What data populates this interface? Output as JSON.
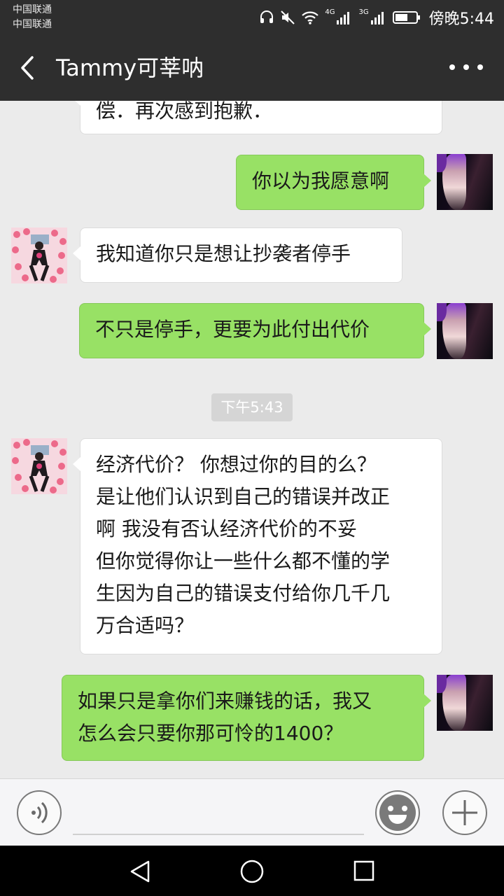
{
  "status_bar": {
    "carrier_1": "中国联通",
    "carrier_2": "中国联通",
    "net_1": "4G",
    "net_2": "3G",
    "time": "傍晚5:44",
    "icons": [
      "headset-icon",
      "mute-icon",
      "wifi-icon",
      "signal-4g-icon",
      "signal-3g-icon",
      "battery-icon"
    ]
  },
  "header": {
    "title": "Tammy可莘呐",
    "back_icon": "back-arrow-icon",
    "more_icon": "more-dots-icon"
  },
  "messages": [
    {
      "side": "left",
      "lines": [
        "偿．再次感到抱歉．"
      ]
    },
    {
      "side": "right",
      "lines": [
        "你以为我愿意啊"
      ]
    },
    {
      "side": "left",
      "lines": [
        "我知道你只是想让抄袭者停手"
      ]
    },
    {
      "side": "right",
      "lines": [
        "不只是停手，更要为此付出代价"
      ]
    },
    {
      "side": "left",
      "lines": [
        "经济代价？  你想过你的目的么？",
        "是让他们认识到自己的错误并改正",
        "啊   我没有否认经济代价的不妥",
        "但你觉得你让一些什么都不懂的学",
        "生因为自己的错误支付给你几千几",
        "万合适吗？"
      ]
    },
    {
      "side": "right",
      "lines": [
        "如果只是拿你们来赚钱的话，我又",
        "怎么会只要你那可怜的1400？"
      ]
    }
  ],
  "time_separator": "下午5:43",
  "input_bar": {
    "voice_icon": "voice-icon",
    "emoji_icon": "emoji-icon",
    "plus_icon": "plus-icon"
  },
  "nav_bar": {
    "icons": [
      "nav-back-icon",
      "nav-home-icon",
      "nav-recents-icon"
    ]
  },
  "colors": {
    "bar_bg": "#2e2e2e",
    "chat_bg": "#ebebeb",
    "self_bubble": "#98e165",
    "peer_bubble": "#ffffff"
  }
}
